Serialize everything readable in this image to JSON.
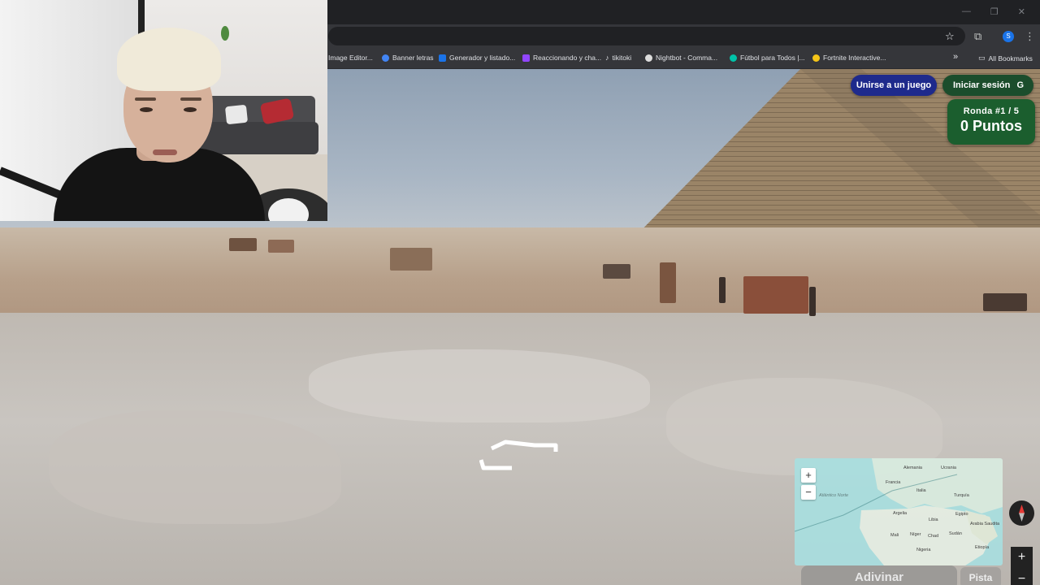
{
  "browser": {
    "window_controls": [
      "—",
      "❐",
      "✕"
    ],
    "profile_initial": "S",
    "bookmarks": [
      {
        "label": "Image Editor...",
        "color": "#e8eaed"
      },
      {
        "label": "Banner letras",
        "color": "#4285f4"
      },
      {
        "label": "Generador y listado...",
        "color": "#1a73e8"
      },
      {
        "label": "Reaccionando y cha...",
        "color": "#9146ff"
      },
      {
        "label": "tikitoki",
        "color": "#ffffff"
      },
      {
        "label": "Nightbot - Comma...",
        "color": "#dddddd"
      },
      {
        "label": "Fútbol para Todos |...",
        "color": "#00c2a8"
      },
      {
        "label": "Fortnite Interactive...",
        "color": "#f5c518"
      }
    ],
    "bookmarks_overflow": "»",
    "all_bookmarks": "All Bookmarks"
  },
  "game": {
    "join_button": "Unirse a un juego",
    "login_button": "Iniciar sesión",
    "login_icon": "G",
    "round_label": "Ronda #1 / 5",
    "points_label": "0 Puntos",
    "guess_button": "Adivinar",
    "hint_button": "Pista",
    "map_zoom_in": "+",
    "map_zoom_out": "−",
    "sv_zoom_in": "+",
    "sv_zoom_out": "−",
    "map_labels": [
      "Alemania",
      "Ucrania",
      "Francia",
      "Italia",
      "Atlántico Norte",
      "Turquía",
      "Argelia",
      "Egipto",
      "Libia",
      "Arabia Saudita",
      "Mali",
      "Níger",
      "Chad",
      "Sudán",
      "Etiopía",
      "Nigeria"
    ]
  },
  "colors": {
    "join_bg": "#1e2a8c",
    "login_bg": "#1b4d2c",
    "score_bg": "#1b5e2e"
  }
}
